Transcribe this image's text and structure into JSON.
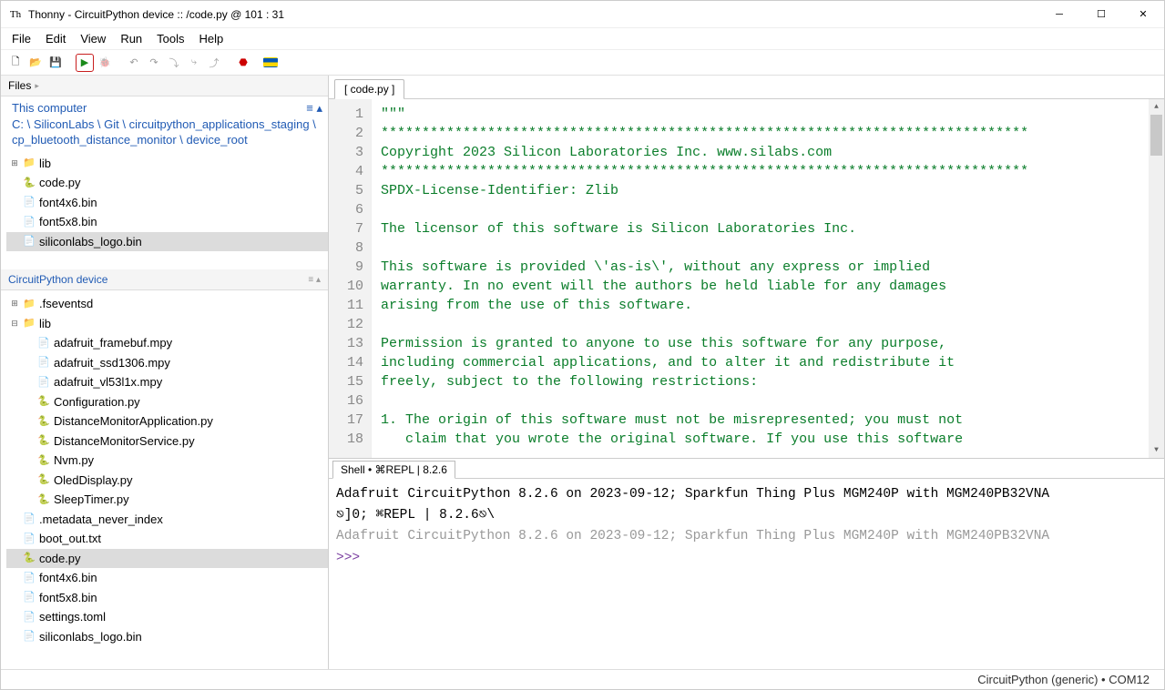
{
  "titlebar": {
    "icon": "Th",
    "text": "Thonny  -  CircuitPython device :: /code.py  @  101 : 31"
  },
  "window_controls": {
    "min": "─",
    "max": "☐",
    "close": "✕"
  },
  "menu": [
    "File",
    "Edit",
    "View",
    "Run",
    "Tools",
    "Help"
  ],
  "toolbar": {
    "new": "🗋",
    "open": "📂",
    "save": "💾",
    "run": "▶",
    "debug": "🐞",
    "undo": "↶",
    "redo": "↷",
    "step_over": "⤵",
    "step_into": "⤷",
    "step_out": "⤴",
    "stop": "⬣",
    "flag": "🟦"
  },
  "files_panel": {
    "title": "Files",
    "section1": "This computer",
    "path": "C: \\ SiliconLabs \\ Git \\ circuitpython_applications_staging \\ cp_bluetooth_distance_monitor \\ device_root",
    "items1": [
      {
        "exp": "⊞",
        "type": "folder",
        "name": "lib"
      },
      {
        "exp": "",
        "type": "py",
        "name": "code.py"
      },
      {
        "exp": "",
        "type": "file",
        "name": "font4x6.bin"
      },
      {
        "exp": "",
        "type": "file",
        "name": "font5x8.bin"
      },
      {
        "exp": "",
        "type": "file",
        "name": "siliconlabs_logo.bin",
        "selected": true
      }
    ],
    "section2": "CircuitPython device",
    "items2": [
      {
        "exp": "⊞",
        "type": "folder",
        "name": ".fseventsd",
        "indent": 0
      },
      {
        "exp": "⊟",
        "type": "folder",
        "name": "lib",
        "indent": 0
      },
      {
        "exp": "",
        "type": "file",
        "name": "adafruit_framebuf.mpy",
        "indent": 1
      },
      {
        "exp": "",
        "type": "file",
        "name": "adafruit_ssd1306.mpy",
        "indent": 1
      },
      {
        "exp": "",
        "type": "file",
        "name": "adafruit_vl53l1x.mpy",
        "indent": 1
      },
      {
        "exp": "",
        "type": "py",
        "name": "Configuration.py",
        "indent": 1
      },
      {
        "exp": "",
        "type": "py",
        "name": "DistanceMonitorApplication.py",
        "indent": 1
      },
      {
        "exp": "",
        "type": "py",
        "name": "DistanceMonitorService.py",
        "indent": 1
      },
      {
        "exp": "",
        "type": "py",
        "name": "Nvm.py",
        "indent": 1
      },
      {
        "exp": "",
        "type": "py",
        "name": "OledDisplay.py",
        "indent": 1
      },
      {
        "exp": "",
        "type": "py",
        "name": "SleepTimer.py",
        "indent": 1
      },
      {
        "exp": "",
        "type": "file",
        "name": ".metadata_never_index",
        "indent": 0
      },
      {
        "exp": "",
        "type": "file",
        "name": "boot_out.txt",
        "indent": 0
      },
      {
        "exp": "",
        "type": "py",
        "name": "code.py",
        "indent": 0,
        "selected": true
      },
      {
        "exp": "",
        "type": "file",
        "name": "font4x6.bin",
        "indent": 0
      },
      {
        "exp": "",
        "type": "file",
        "name": "font5x8.bin",
        "indent": 0
      },
      {
        "exp": "",
        "type": "file",
        "name": "settings.toml",
        "indent": 0
      },
      {
        "exp": "",
        "type": "file",
        "name": "siliconlabs_logo.bin",
        "indent": 0
      }
    ]
  },
  "editor": {
    "tab": "[ code.py ]",
    "lines": [
      "\"\"\"",
      "*******************************************************************************",
      "Copyright 2023 Silicon Laboratories Inc. www.silabs.com",
      "*******************************************************************************",
      "SPDX-License-Identifier: Zlib",
      "",
      "The licensor of this software is Silicon Laboratories Inc.",
      "",
      "This software is provided \\'as-is\\', without any express or implied",
      "warranty. In no event will the authors be held liable for any damages",
      "arising from the use of this software.",
      "",
      "Permission is granted to anyone to use this software for any purpose,",
      "including commercial applications, and to alter it and redistribute it",
      "freely, subject to the following restrictions:",
      "",
      "1. The origin of this software must not be misrepresented; you must not",
      "   claim that you wrote the original software. If you use this software"
    ]
  },
  "shell": {
    "tab": "Shell • ⌘REPL | 8.2.6",
    "l1": " Adafruit CircuitPython 8.2.6 on 2023-09-12; Sparkfun Thing Plus MGM240P with MGM240PB32VNA",
    "l2": "⎋]0; ⌘REPL | 8.2.6⎋\\",
    "l3": "Adafruit CircuitPython 8.2.6 on 2023-09-12; Sparkfun Thing Plus MGM240P with MGM240PB32VNA",
    "prompt": ">>>"
  },
  "statusbar": "CircuitPython (generic)  •  COM12"
}
